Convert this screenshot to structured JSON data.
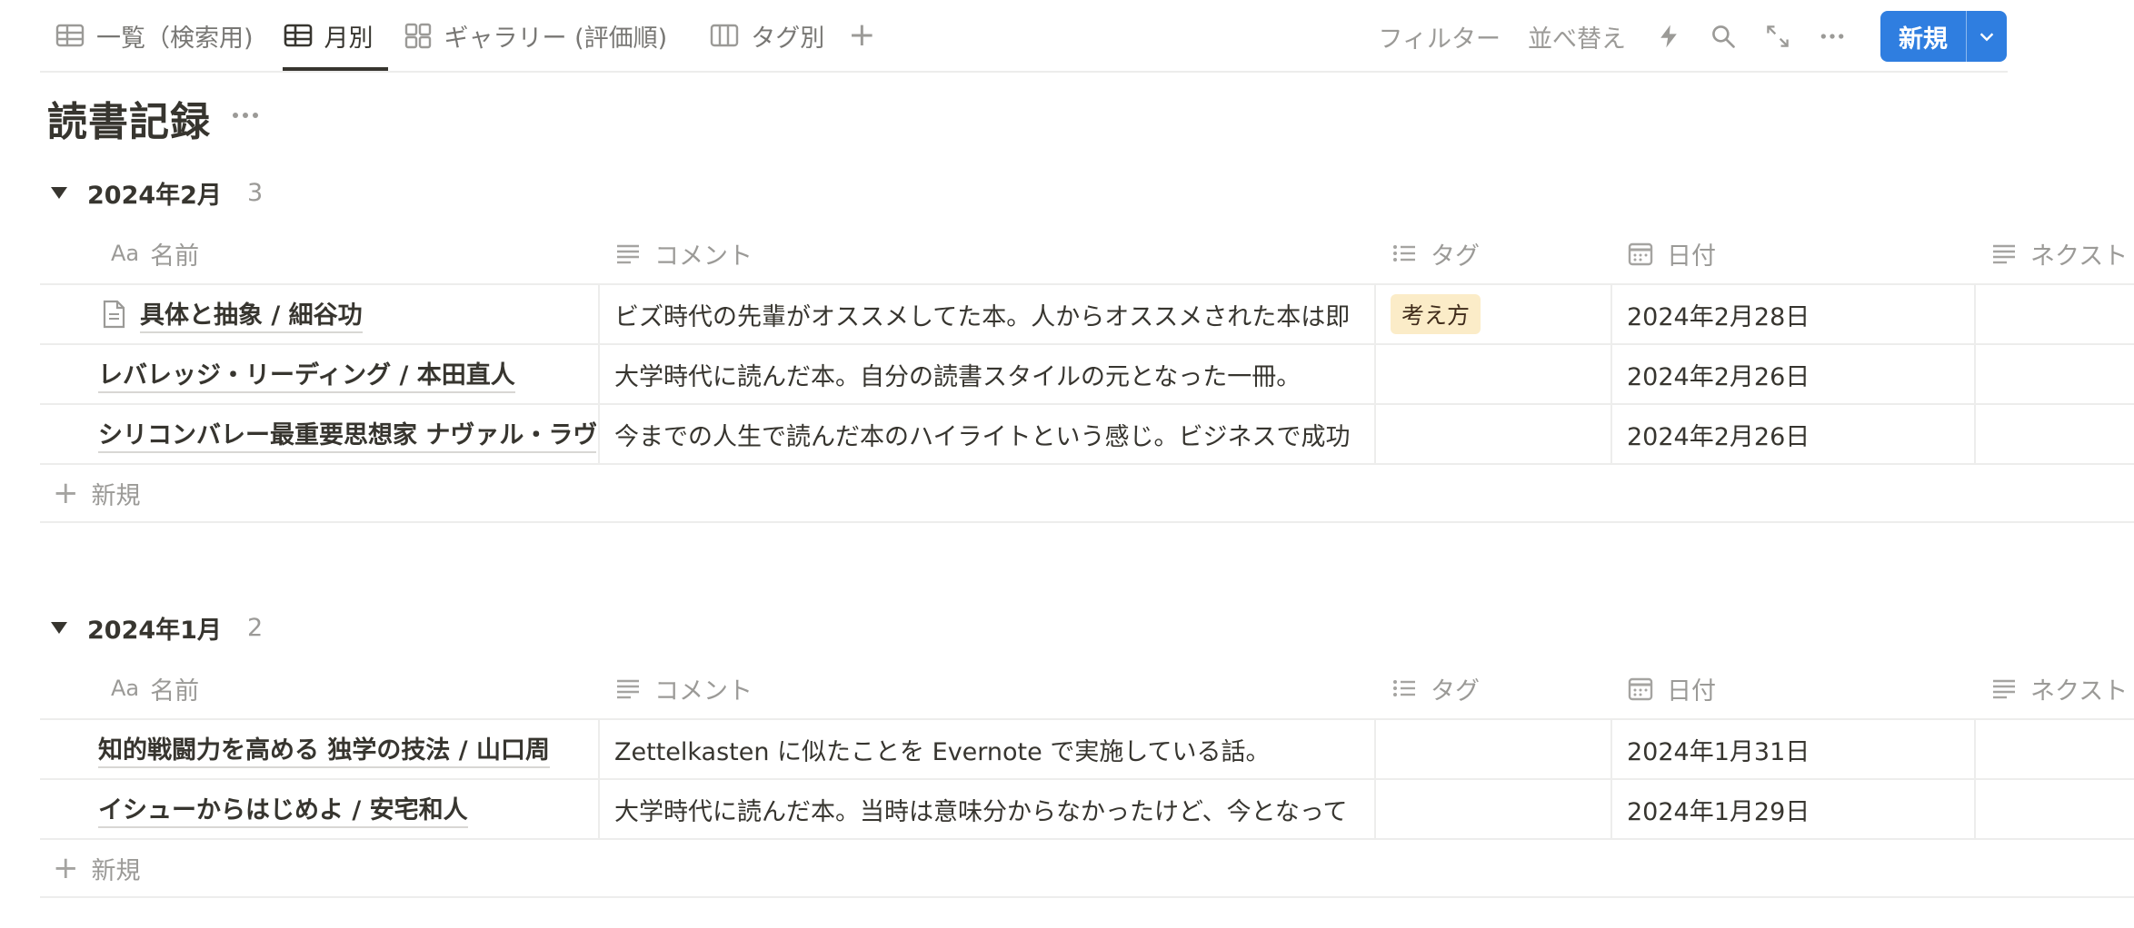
{
  "tabs": [
    {
      "label": "一覧（検索用)",
      "icon": "table-icon",
      "active": false
    },
    {
      "label": "月別",
      "icon": "table-icon",
      "active": true
    },
    {
      "label": "ギャラリー (評価順)",
      "icon": "gallery-icon",
      "active": false
    },
    {
      "label": "タグ別",
      "icon": "board-icon",
      "active": false
    }
  ],
  "tab_add": "+",
  "toolbar": {
    "filter_label": "フィルター",
    "sort_label": "並べ替え",
    "new_label": "新規"
  },
  "page": {
    "title": "読書記録"
  },
  "columns": {
    "name": "名前",
    "name_prefix": "Aa",
    "comment": "コメント",
    "tag": "タグ",
    "date": "日付",
    "next": "ネクスト"
  },
  "groups": [
    {
      "name": "2024年2月",
      "count": "3",
      "rows": [
        {
          "title": "具体と抽象 / 細谷功",
          "has_icon": true,
          "comment": "ビズ時代の先輩がオススメしてた本。人からオススメされた本は即",
          "tag": "考え方",
          "date": "2024年2月28日"
        },
        {
          "title": "レバレッジ・リーディング / 本田直人",
          "has_icon": false,
          "comment": "大学時代に読んだ本。自分の読書スタイルの元となった一冊。",
          "tag": "",
          "date": "2024年2月26日"
        },
        {
          "title": "シリコンバレー最重要思想家 ナヴァル・ラヴ",
          "has_icon": false,
          "comment": "今までの人生で読んだ本のハイライトという感じ。ビジネスで成功",
          "tag": "",
          "date": "2024年2月26日"
        }
      ],
      "new_label": "新規"
    },
    {
      "name": "2024年1月",
      "count": "2",
      "rows": [
        {
          "title": "知的戦闘力を高める 独学の技法 / 山口周",
          "has_icon": false,
          "comment": "Zettelkasten に似たことを Evernote で実施している話。",
          "tag": "",
          "date": "2024年1月31日"
        },
        {
          "title": "イシューからはじめよ / 安宅和人",
          "has_icon": false,
          "comment": "大学時代に読んだ本。当時は意味分からなかったけど、今となって",
          "tag": "",
          "date": "2024年1月29日"
        }
      ],
      "new_label": "新規"
    }
  ]
}
